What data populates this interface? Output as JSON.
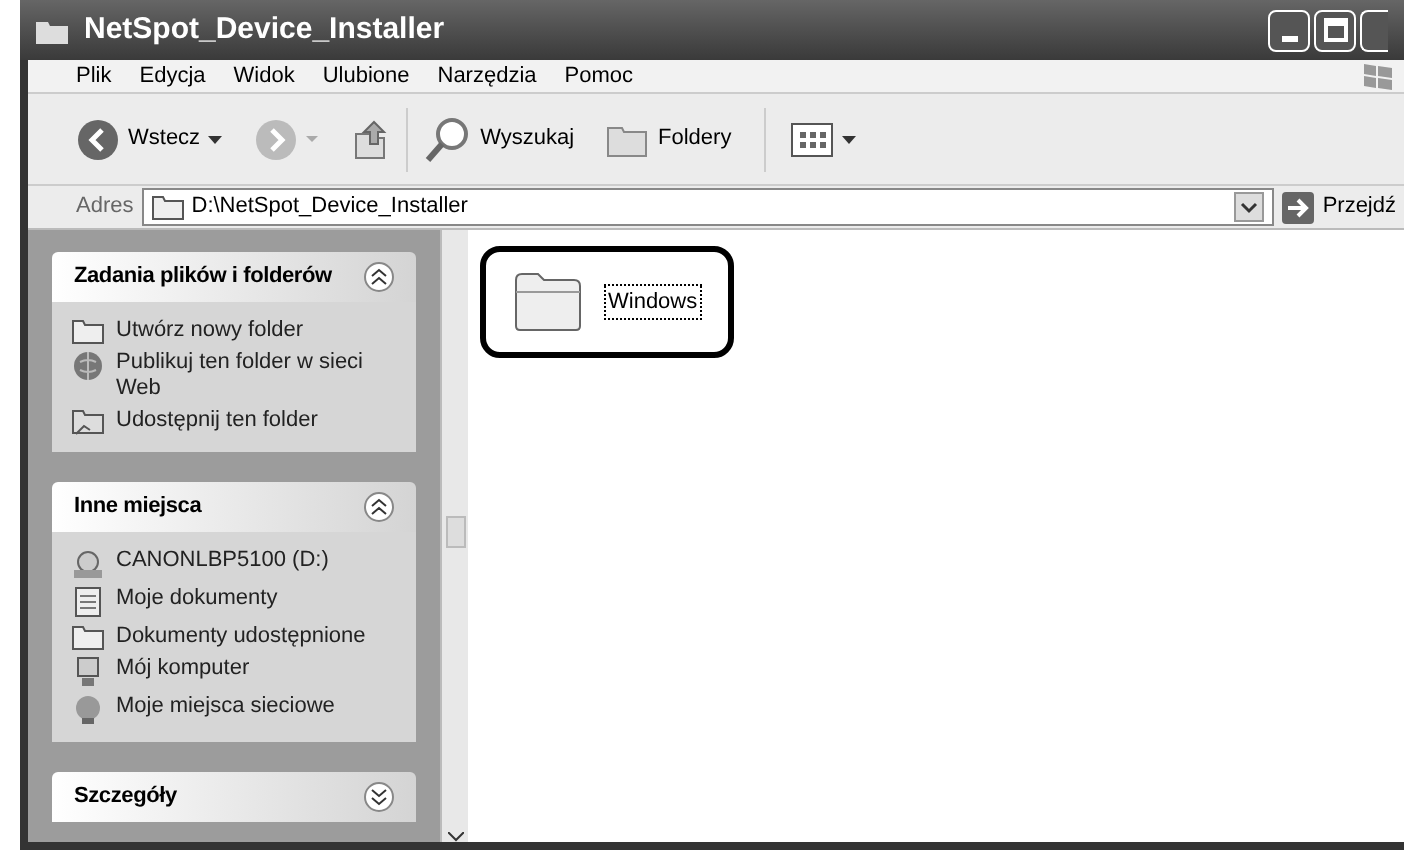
{
  "window": {
    "title": "NetSpot_Device_Installer"
  },
  "menu": [
    "Plik",
    "Edycja",
    "Widok",
    "Ulubione",
    "Narzędzia",
    "Pomoc"
  ],
  "toolbar": {
    "back": "Wstecz",
    "search": "Wyszukaj",
    "folders": "Foldery"
  },
  "address": {
    "label": "Adres",
    "value": "D:\\NetSpot_Device_Installer",
    "go": "Przejdź"
  },
  "sidebar": [
    {
      "title": "Zadania plików i folderów",
      "expanded": true,
      "items": [
        "Utwórz nowy folder",
        "Publikuj ten folder w sieci Web",
        "Udostępnij ten folder"
      ]
    },
    {
      "title": "Inne miejsca",
      "expanded": true,
      "items": [
        "CANONLBP5100 (D:)",
        "Moje dokumenty",
        "Dokumenty udostępnione",
        "Mój komputer",
        "Moje miejsca sieciowe"
      ]
    },
    {
      "title": "Szczegóły",
      "expanded": false
    }
  ],
  "files": [
    {
      "name": "Windows",
      "focused": true,
      "highlighted": true
    }
  ]
}
